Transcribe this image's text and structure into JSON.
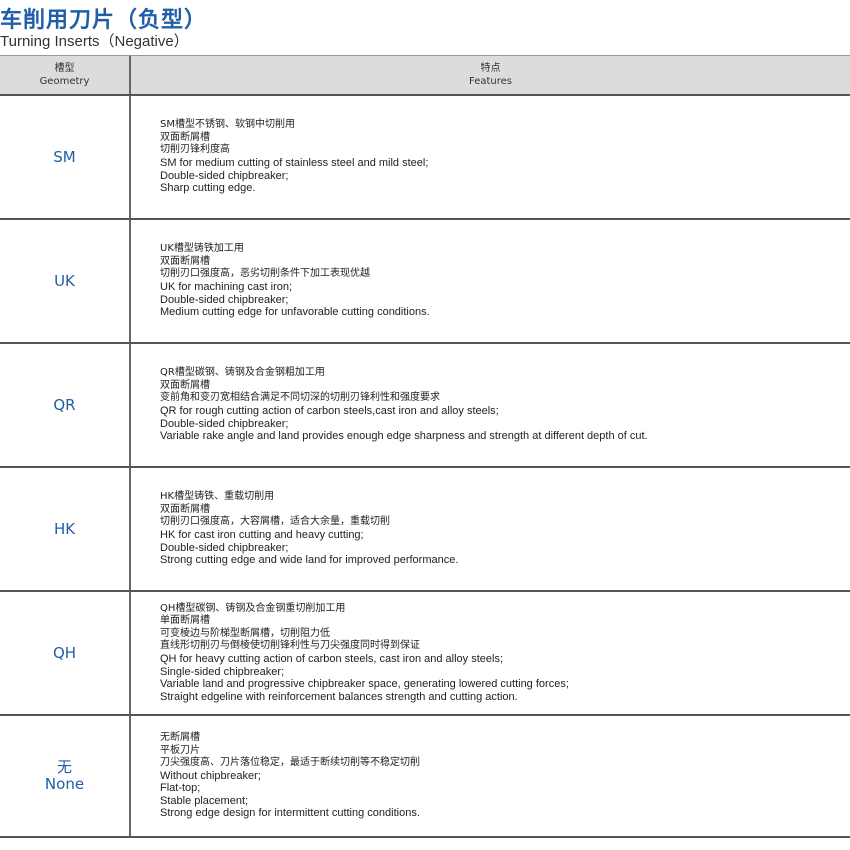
{
  "page": {
    "title_cn": "车削用刀片（负型）",
    "title_en": "Turning Inserts（Negative）"
  },
  "table": {
    "headers": {
      "geometry_cn": "槽型",
      "geometry_en": "Geometry",
      "features_cn": "特点",
      "features_en": "Features"
    },
    "rows": [
      {
        "geometry": [
          "SM"
        ],
        "features": [
          "SM槽型不锈钢、软钢中切削用",
          "双面断屑槽",
          "切削刃锋利度高",
          "SM for medium cutting of stainless steel and mild steel;",
          "Double-sided chipbreaker;",
          "Sharp cutting edge."
        ]
      },
      {
        "geometry": [
          "UK"
        ],
        "features": [
          "UK槽型铸铁加工用",
          "双面断屑槽",
          "切削刃口强度高，恶劣切削条件下加工表现优越",
          "UK for machining cast iron;",
          "Double-sided chipbreaker;",
          "Medium cutting edge for unfavorable cutting conditions."
        ]
      },
      {
        "geometry": [
          "QR"
        ],
        "features": [
          "QR槽型碳钢、铸钢及合金钢粗加工用",
          "双面断屑槽",
          "变前角和变刃宽相结合满足不同切深的切削刃锋利性和强度要求",
          "QR for rough cutting action of carbon steels,cast iron and alloy steels;",
          "Double-sided chipbreaker;",
          "Variable rake angle and land provides enough edge sharpness and strength at different depth of cut."
        ]
      },
      {
        "geometry": [
          "HK"
        ],
        "features": [
          "HK槽型铸铁、重载切削用",
          "双面断屑槽",
          "切削刃口强度高，大容屑槽，适合大余量，重载切削",
          "HK for cast iron cutting and heavy cutting;",
          "Double-sided chipbreaker;",
          "Strong cutting edge and wide land for improved performance."
        ]
      },
      {
        "geometry": [
          "QH"
        ],
        "features": [
          "QH槽型碳钢、铸钢及合金钢重切削加工用",
          "单面断屑槽",
          "可变棱边与阶梯型断屑槽，切削阻力低",
          "直线形切削刃与倒棱使切削锋利性与刀尖强度同时得到保证",
          "QH for heavy cutting action of carbon steels, cast iron and alloy steels;",
          "Single-sided chipbreaker;",
          "Variable land and progressive chipbreaker space, generating lowered cutting forces;",
          "Straight edgeline with reinforcement balances strength and cutting action."
        ]
      },
      {
        "geometry": [
          "无",
          "None"
        ],
        "features": [
          "无断屑槽",
          "平板刀片",
          "刀尖强度高、刀片落位稳定，最适于断续切削等不稳定切削",
          "Without chipbreaker;",
          "Flat-top;",
          "Stable placement;",
          "Strong edge design for intermittent cutting conditions."
        ]
      }
    ]
  },
  "colors": {
    "accent": "#1f5fa8",
    "header_bg": "#dcdcdc",
    "rule": "#555555"
  }
}
